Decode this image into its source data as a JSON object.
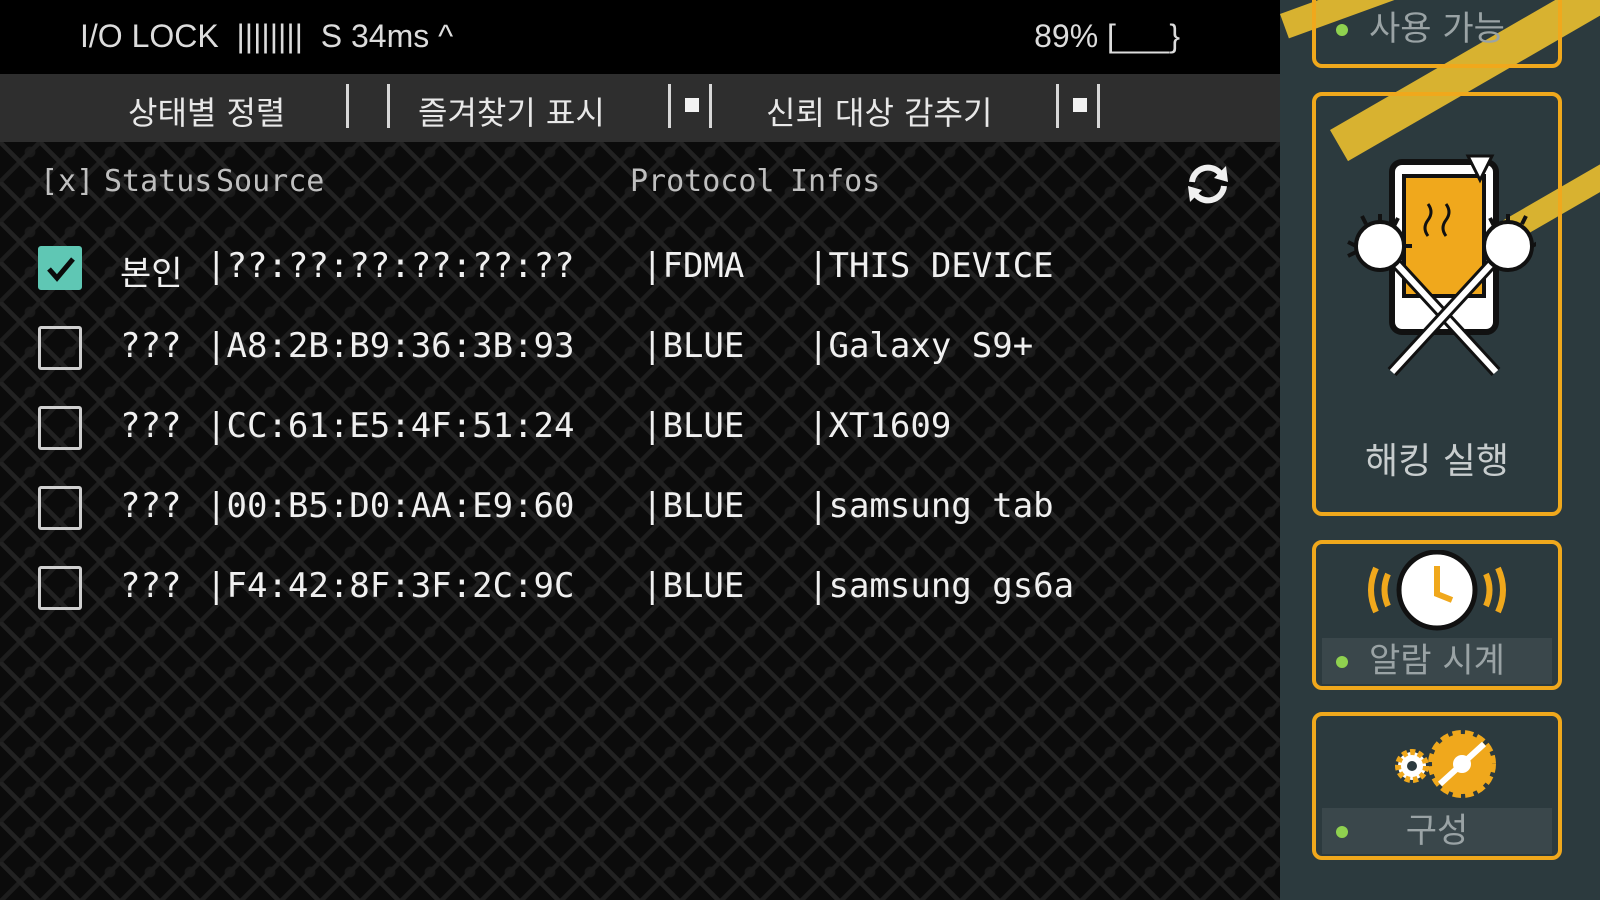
{
  "status_bar": {
    "left_text": "I/O LOCK  ||||||||  S 34ms ^",
    "right_text": "89% [___}"
  },
  "filters": [
    {
      "label": "상태별 정렬",
      "checked": false
    },
    {
      "label": "즐겨찾기 표시",
      "checked": true
    },
    {
      "label": "신뢰 대상 감추기",
      "checked": true
    }
  ],
  "table": {
    "headers": {
      "x": "[x]",
      "status": "Status",
      "source": "Source",
      "protocol": "Protocol",
      "infos": "Infos"
    },
    "rows": [
      {
        "checked": true,
        "status": "본인",
        "source": "|??:??:??:??:??:??",
        "protocol": "|FDMA",
        "info": "|THIS DEVICE"
      },
      {
        "checked": false,
        "status": "???",
        "source": "|A8:2B:B9:36:3B:93",
        "protocol": "|BLUE",
        "info": "|Galaxy S9+"
      },
      {
        "checked": false,
        "status": "???",
        "source": "|CC:61:E5:4F:51:24",
        "protocol": "|BLUE",
        "info": "|XT1609"
      },
      {
        "checked": false,
        "status": "???",
        "source": "|00:B5:D0:AA:E9:60",
        "protocol": "|BLUE",
        "info": "|samsung tab"
      },
      {
        "checked": false,
        "status": "???",
        "source": "|F4:42:8F:3F:2C:9C",
        "protocol": "|BLUE",
        "info": "|samsung gs6a"
      }
    ]
  },
  "side_panel": {
    "top_card_label": "사용 가능",
    "hack_card_label": "해킹 실행",
    "alarm_card_label": "알람 시계",
    "config_card_label": "구성"
  },
  "icons": {
    "refresh": "refresh-icon",
    "hack": "hack-icon",
    "alarm": "alarm-clock-icon",
    "config": "gears-icon"
  },
  "colors": {
    "accent_orange": "#f0a81c",
    "check_teal": "#5fc7b4",
    "panel_bg": "#2c3a3e",
    "stripe_yellow": "#d8b230",
    "ready_dot": "#8fd14f"
  }
}
